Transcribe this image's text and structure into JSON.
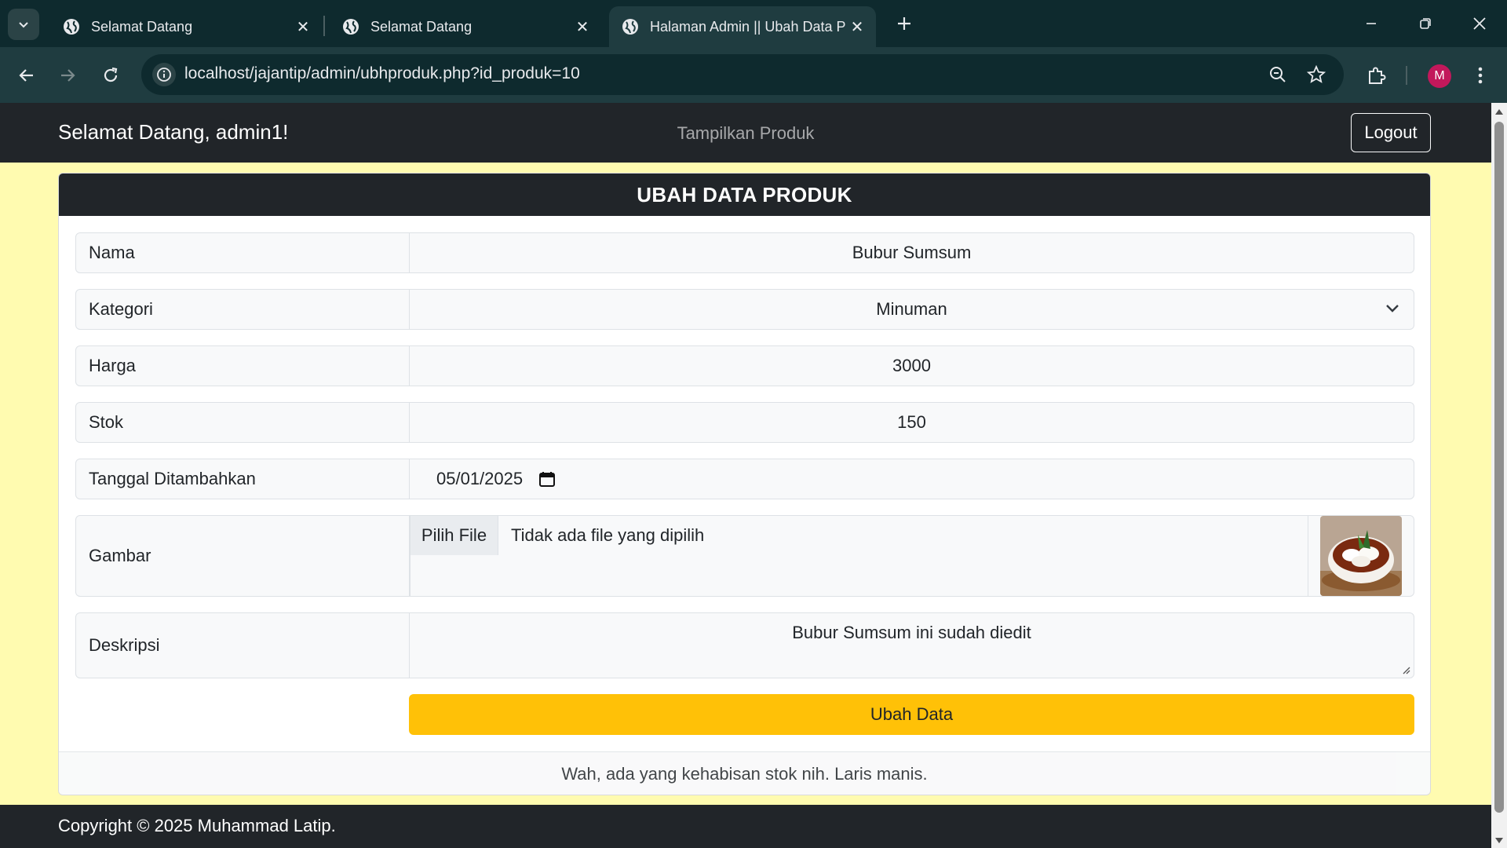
{
  "browser": {
    "tabs": [
      {
        "title": "Selamat Datang",
        "icon": "globe-icon",
        "active": false
      },
      {
        "title": "Selamat Datang",
        "icon": "globe-icon",
        "active": false
      },
      {
        "title": "Halaman Admin || Ubah Data Pr",
        "icon": "globe-icon",
        "active": true
      }
    ],
    "url": "localhost/jajantip/admin/ubhproduk.php?id_produk=10",
    "profile_initial": "M"
  },
  "navbar": {
    "brand": "Selamat Datang, admin1!",
    "link": "Tampilkan Produk",
    "logout_label": "Logout"
  },
  "form": {
    "title": "UBAH DATA PRODUK",
    "fields": [
      {
        "label": "Nama",
        "value": "Bubur Sumsum"
      },
      {
        "label": "Kategori",
        "value": "Minuman"
      },
      {
        "label": "Harga",
        "value": "3000"
      },
      {
        "label": "Stok",
        "value": "150"
      },
      {
        "label": "Tanggal Ditambahkan",
        "value": "05/01/2025"
      },
      {
        "label": "Gambar",
        "file_button": "Pilih File",
        "file_status": "Tidak ada file yang dipilih"
      },
      {
        "label": "Deskripsi",
        "value": "Bubur Sumsum ini sudah diedit"
      }
    ],
    "submit_label": "Ubah Data",
    "footer_note": "Wah, ada yang kehabisan stok nih. Laris manis."
  },
  "footer": {
    "copyright": "Copyright © 2025 Muhammad Latip."
  },
  "colors": {
    "page_bg": "#fffbb0",
    "dark": "#212529",
    "warning": "#ffc107"
  }
}
